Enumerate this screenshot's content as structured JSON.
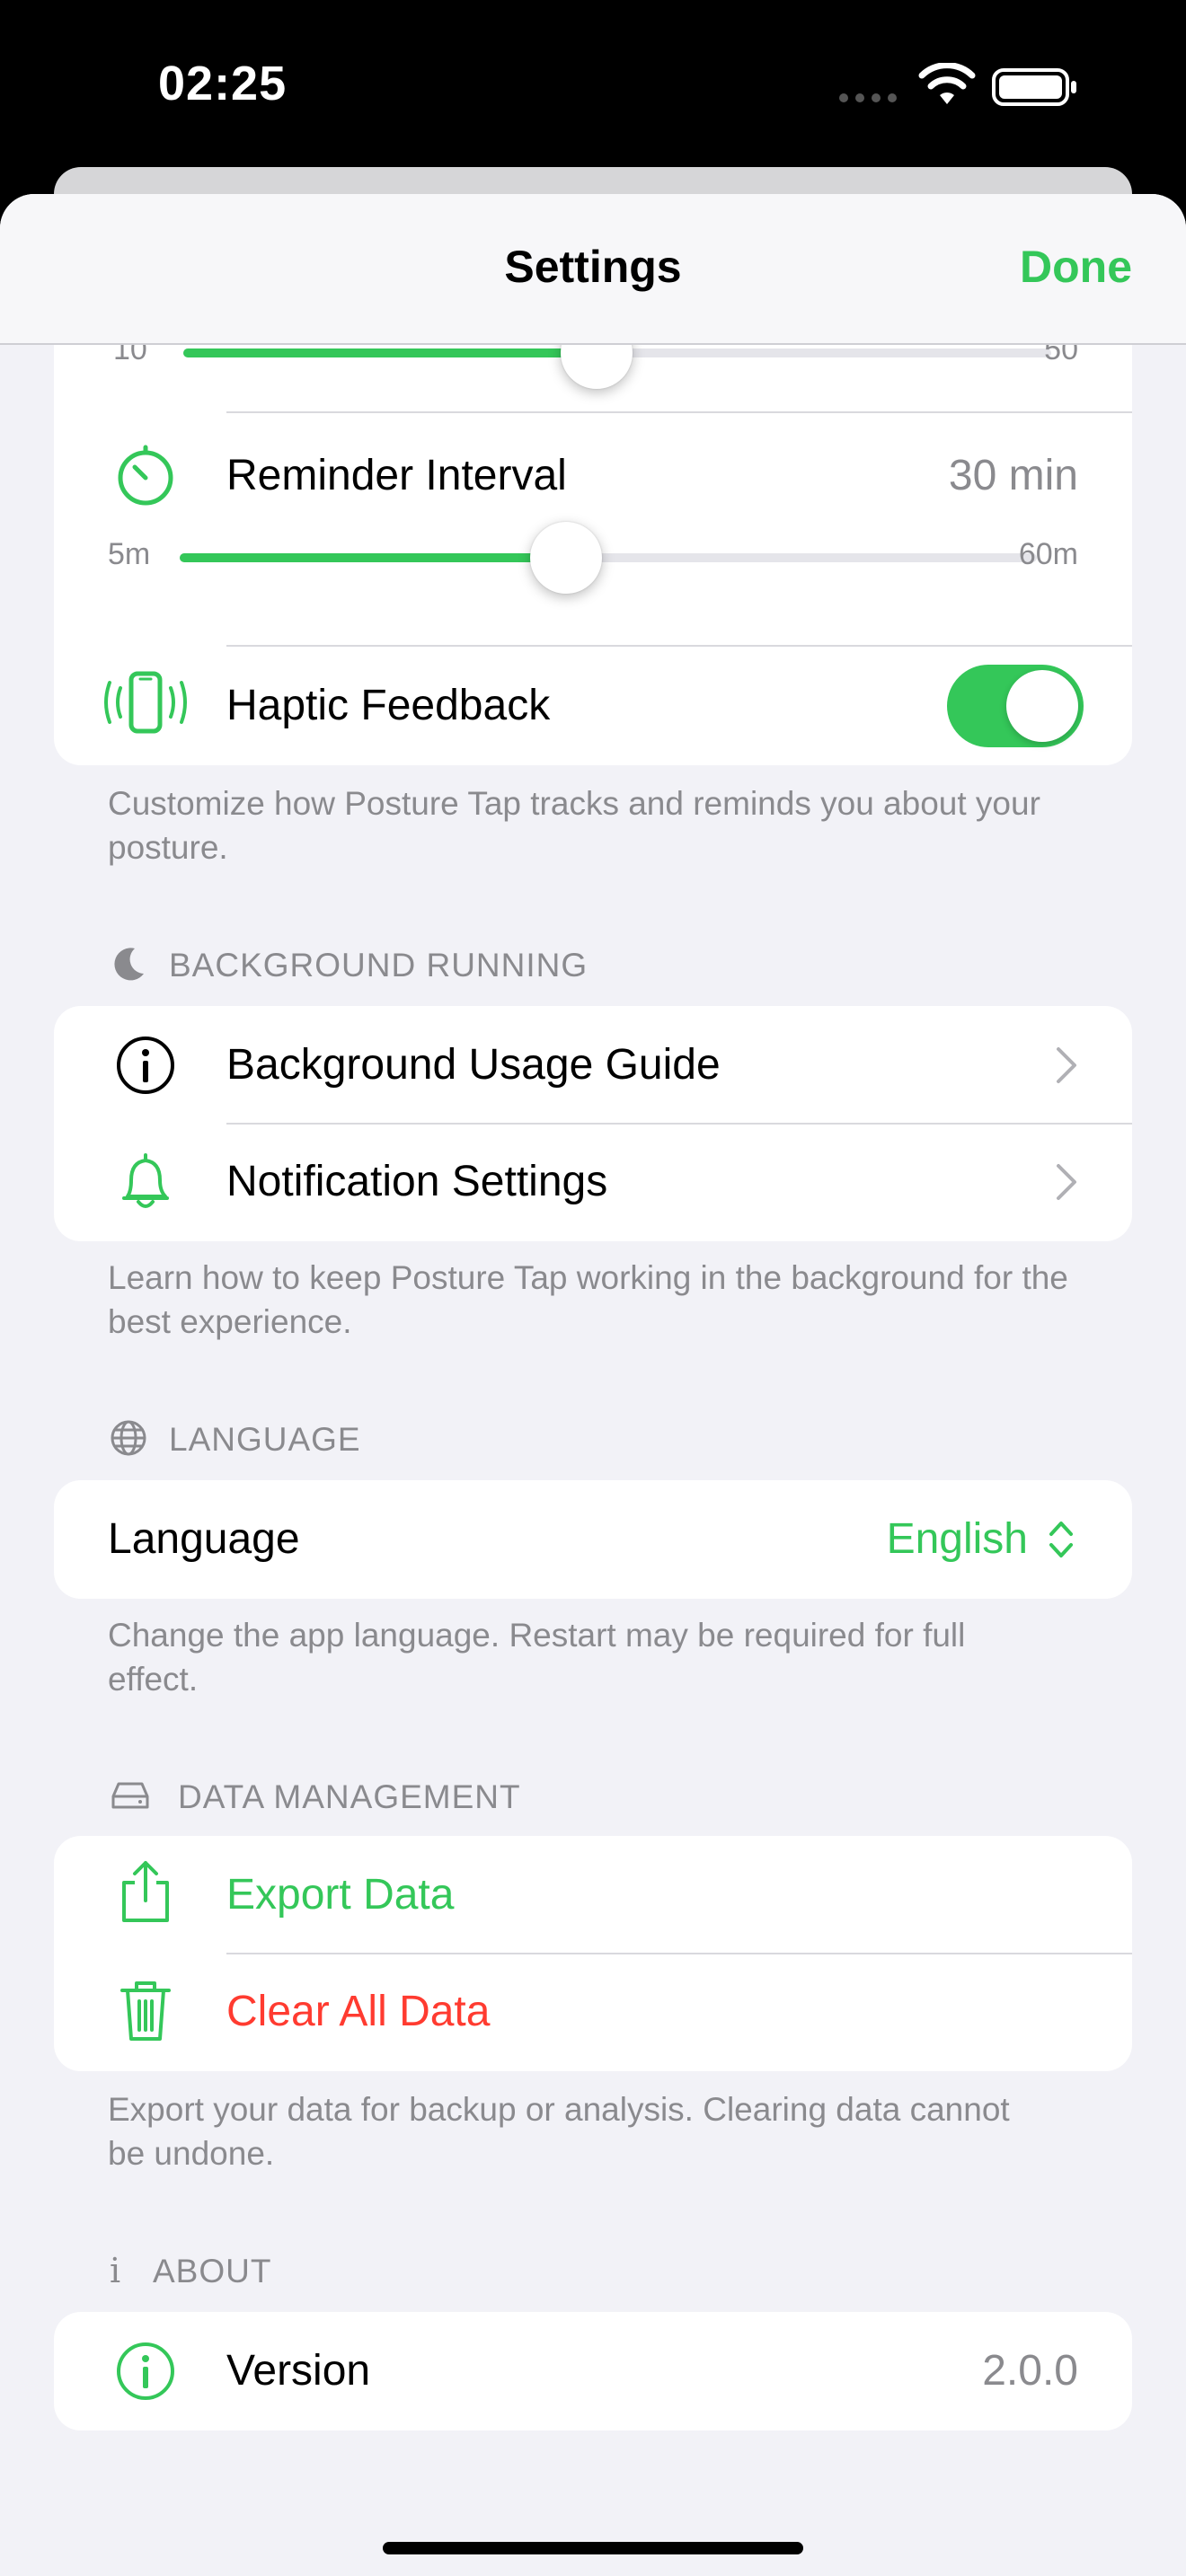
{
  "status_bar": {
    "time": "02:25"
  },
  "nav": {
    "title": "Settings",
    "done_label": "Done"
  },
  "colors": {
    "accent": "#34c759",
    "destructive": "#ff3b30",
    "secondary_text": "#8a8a8e"
  },
  "tracking": {
    "partial_slider": {
      "min_label": "10",
      "max_label": "50",
      "fraction": 0.5
    },
    "reminder_interval": {
      "label": "Reminder Interval",
      "value": "30 min",
      "icon": "timer-icon",
      "slider": {
        "min_label": "5m",
        "max_label": "60m",
        "fraction": 0.45
      }
    },
    "haptic_feedback": {
      "label": "Haptic Feedback",
      "icon": "phone-vibrate-icon",
      "enabled": true
    },
    "footer": "Customize how Posture Tap tracks and reminds you about your posture."
  },
  "background_running": {
    "header": "BACKGROUND RUNNING",
    "header_icon": "moon-icon",
    "items": [
      {
        "label": "Background Usage Guide",
        "icon": "info-circle-icon"
      },
      {
        "label": "Notification Settings",
        "icon": "bell-icon"
      }
    ],
    "footer": "Learn how to keep Posture Tap working in the background for the best experience."
  },
  "language": {
    "header": "LANGUAGE",
    "header_icon": "globe-icon",
    "label": "Language",
    "value": "English",
    "footer": "Change the app language. Restart may be required for full effect."
  },
  "data_management": {
    "header": "DATA MANAGEMENT",
    "header_icon": "drive-icon",
    "export_label": "Export Data",
    "clear_label": "Clear All Data",
    "footer": "Export your data for backup or analysis. Clearing data cannot be undone."
  },
  "about": {
    "header": "ABOUT",
    "header_icon": "info-small-icon",
    "version_label": "Version",
    "version_value": "2.0.0"
  }
}
